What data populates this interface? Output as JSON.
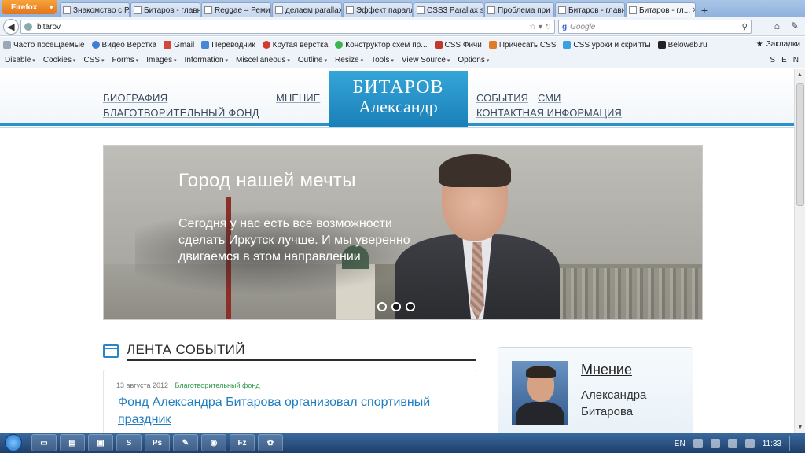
{
  "browser": {
    "menu_button": "Firefox",
    "tabs": [
      {
        "label": "Знакомство с Р..."
      },
      {
        "label": "Битаров - главн..."
      },
      {
        "label": "Reggae – Ремик..."
      },
      {
        "label": "делаем parallax ..."
      },
      {
        "label": "Эффект паралл..."
      },
      {
        "label": "CSS3 Parallax scr..."
      },
      {
        "label": "Проблема при ..."
      },
      {
        "label": "Битаров - главн..."
      },
      {
        "label": "Битаров - гл..."
      }
    ],
    "new_tab": "+",
    "url": "bitarov",
    "search_placeholder": "Google",
    "bookmarks": [
      {
        "label": "Часто посещаемые",
        "color": "#9aa6b6"
      },
      {
        "label": "Видео Верстка",
        "color": "#3d7fd0"
      },
      {
        "label": "Gmail",
        "color": "#d44638"
      },
      {
        "label": "Переводчик",
        "color": "#4a86d8"
      },
      {
        "label": "Крутая вёрстка",
        "color": "#d23a2a"
      },
      {
        "label": "Конструктор схем пр...",
        "color": "#3fb34f"
      },
      {
        "label": "CSS Фичи",
        "color": "#c0392b"
      },
      {
        "label": "Причесать CSS",
        "color": "#e07b2a"
      },
      {
        "label": "CSS уроки и скрипты",
        "color": "#3aa0e0"
      },
      {
        "label": "Beloweb.ru",
        "color": "#222222"
      }
    ],
    "bookmarks_right": "Закладки",
    "devtools": [
      "Disable",
      "Cookies",
      "CSS",
      "Forms",
      "Images",
      "Information",
      "Miscellaneous",
      "Outline",
      "Resize",
      "Tools",
      "View Source",
      "Options"
    ],
    "devtools_right": [
      "S",
      "E",
      "N"
    ]
  },
  "site": {
    "menu_left": [
      "БИОГРАФИЯ",
      "БЛАГОТВОРИТЕЛЬНЫЙ ФОНД"
    ],
    "menu_mid": "МНЕНИЕ",
    "logo_line1": "БИТАРОВ",
    "logo_line2": "Александр",
    "menu_right_row1": [
      "СОБЫТИЯ",
      "СМИ"
    ],
    "menu_right_row2": "КОНТАКТНАЯ ИНФОРМАЦИЯ",
    "slide": {
      "title": "Город нашей мечты",
      "text": "Сегодня у нас есть все возможности сделать Иркутск лучше. И мы уверенно двигаемся в этом направлении"
    },
    "news": {
      "heading": "ЛЕНТА СОБЫТИЙ",
      "items": [
        {
          "date": "13 августа 2012",
          "category": "Благотворительный фонд",
          "title": "Фонд Александра Битарова организовал спортивный праздник"
        }
      ]
    },
    "opinion": {
      "title": "Мнение",
      "name": "Александра Битарова"
    }
  },
  "taskbar": {
    "items": [
      "",
      "",
      "",
      "S",
      "Ps",
      "",
      "",
      "Fz",
      ""
    ],
    "lang": "EN",
    "time": "11:33"
  }
}
